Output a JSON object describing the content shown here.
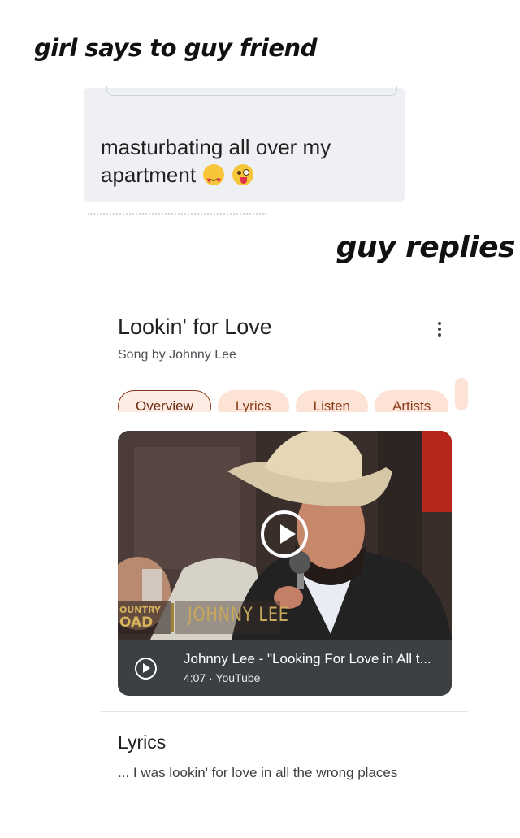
{
  "captions": {
    "top": "girl says to guy friend",
    "right": "guy replies"
  },
  "chat": {
    "message": "masturbating all over my apartment",
    "emojis": [
      "heart-eyes-emoji",
      "zany-face-emoji"
    ]
  },
  "song": {
    "title": "Lookin' for Love",
    "subtitle": "Song by Johnny Lee",
    "menu_icon": "more-vert-icon"
  },
  "tabs": [
    {
      "label": "Overview",
      "active": true
    },
    {
      "label": "Lyrics",
      "active": false
    },
    {
      "label": "Listen",
      "active": false
    },
    {
      "label": "Artists",
      "active": false
    }
  ],
  "video": {
    "title": "Johnny Lee - \"Looking For Love in All t...",
    "meta": "4:07 · YouTube",
    "overlay_left": "OUNTRY",
    "overlay_left2": "OAD",
    "overlay_name": "JOHNNY LEE"
  },
  "lyrics": {
    "heading": "Lyrics",
    "snippet": "... I was lookin' for love in all the wrong places"
  },
  "colors": {
    "chip_bg": "#fde3d5",
    "chip_text": "#8a3b1b",
    "video_info_bg": "#3c4043"
  }
}
